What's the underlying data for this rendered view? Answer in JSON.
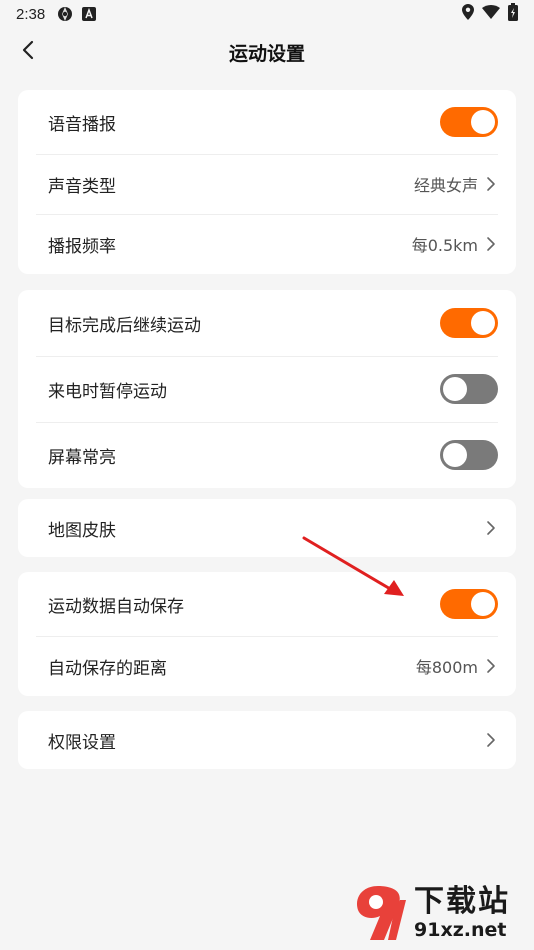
{
  "status_bar": {
    "time": "2:38",
    "left_icons": [
      "aperture-icon",
      "a-badge-icon"
    ],
    "right_icons": [
      "location-icon",
      "wifi-icon",
      "battery-icon"
    ]
  },
  "header": {
    "title": "运动设置",
    "back_icon": "back-chevron-icon"
  },
  "cards": [
    {
      "rows": [
        {
          "label": "语音播报",
          "type": "toggle",
          "on": true
        },
        {
          "label": "声音类型",
          "type": "link",
          "value": "经典女声"
        },
        {
          "label": "播报频率",
          "type": "link",
          "value": "每0.5km"
        }
      ]
    },
    {
      "rows": [
        {
          "label": "目标完成后继续运动",
          "type": "toggle",
          "on": true
        },
        {
          "label": "来电时暂停运动",
          "type": "toggle",
          "on": false
        },
        {
          "label": "屏幕常亮",
          "type": "toggle",
          "on": false
        }
      ]
    },
    {
      "rows": [
        {
          "label": "地图皮肤",
          "type": "link",
          "value": ""
        }
      ]
    },
    {
      "rows": [
        {
          "label": "运动数据自动保存",
          "type": "toggle",
          "on": true
        },
        {
          "label": "自动保存的距离",
          "type": "link",
          "value": "每800m"
        }
      ]
    },
    {
      "rows": [
        {
          "label": "权限设置",
          "type": "link",
          "value": ""
        }
      ]
    }
  ],
  "colors": {
    "toggle_on": "#ff6a00",
    "toggle_off": "#7a7a7a",
    "background": "#f5f5f5",
    "annotation_arrow": "#e02020"
  },
  "watermark": {
    "logo_icon": "91-logo-icon",
    "title": "下载站",
    "url": "91xz.net"
  }
}
